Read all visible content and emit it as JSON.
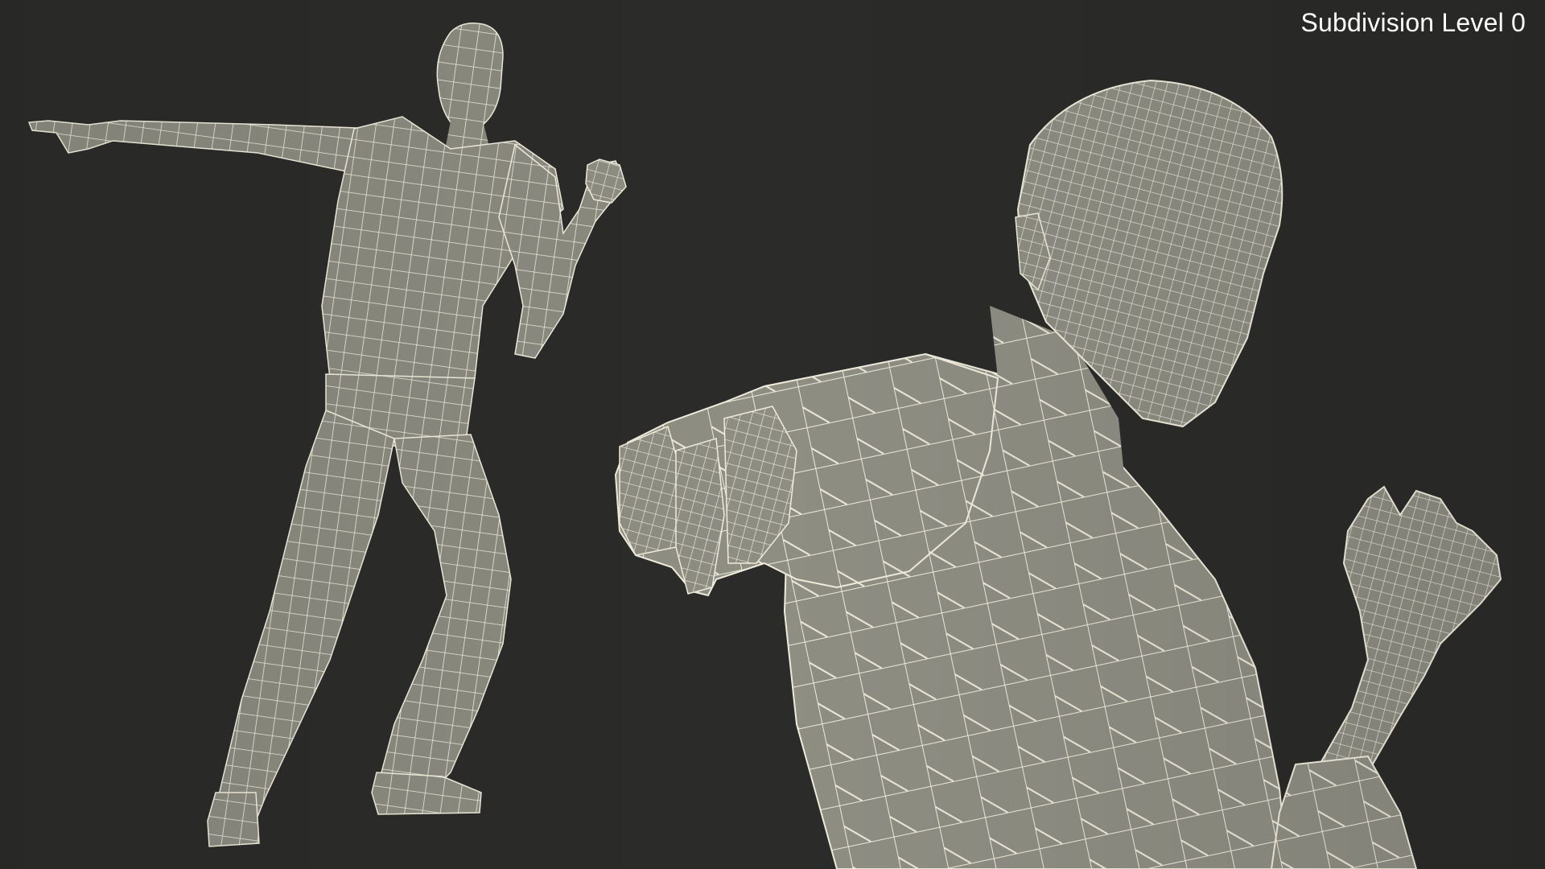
{
  "overlay": {
    "subdivision_label": "Subdivision Level 0"
  },
  "colors": {
    "background": "#2b2b29",
    "mesh_fill": "#8c8c80",
    "mesh_wire": "#f0eddd",
    "label_text": "#ffffff"
  },
  "views": [
    {
      "name": "full-body-view",
      "subject": "wireframe-male-figure-pointing"
    },
    {
      "name": "closeup-view",
      "subject": "wireframe-male-figure-pointing-closeup"
    }
  ]
}
